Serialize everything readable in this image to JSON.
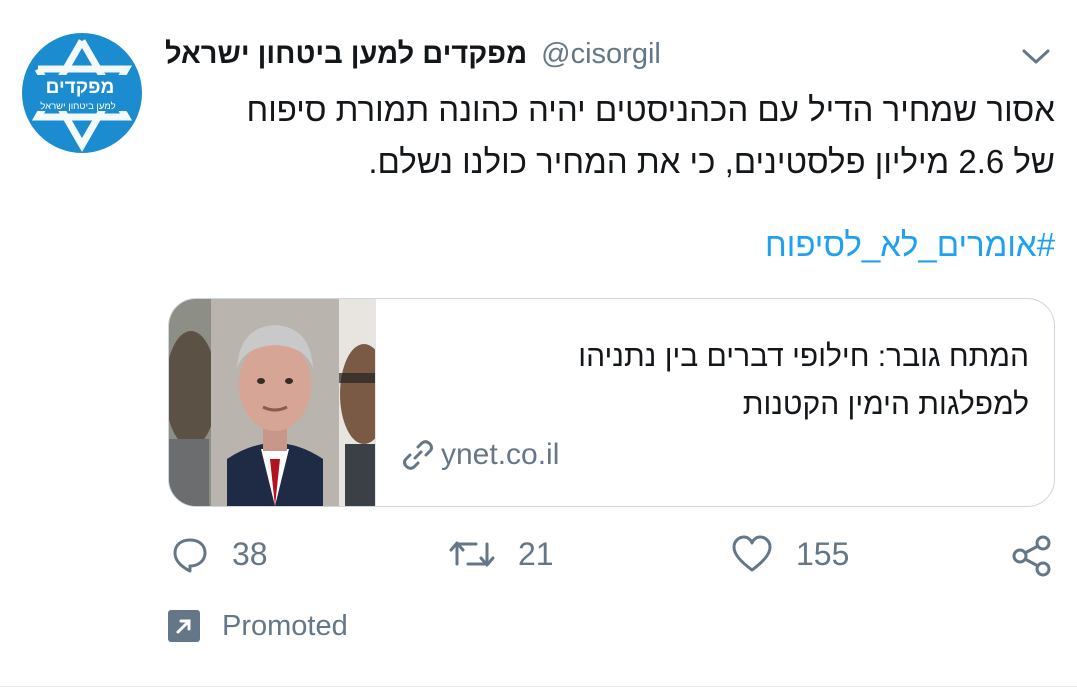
{
  "tweet": {
    "display_name": "מפקדים למען ביטחון ישראל",
    "handle": "@cisorgil",
    "avatar": {
      "logo_title": "מפקדים",
      "logo_subtitle": "למען ביטחון ישראל"
    },
    "text_line1": "אסור שמחיר הדיל עם הכהניסטים יהיה כהונה תמורת סיפוח",
    "text_line2": "של 2.6 מיליון פלסטינים, כי את המחיר כולנו נשלם.",
    "hashtag": "#אומרים_לא_לסיפוח",
    "card": {
      "title_line1": "המתח גובר: חילופי דברים בין נתניהו",
      "title_line2": "למפלגות הימין הקטנות",
      "domain": "ynet.co.il"
    },
    "actions": {
      "reply_count": "38",
      "retweet_count": "21",
      "like_count": "155"
    },
    "promoted_label": "Promoted"
  },
  "colors": {
    "brand_blue": "#1c8cd0",
    "link_blue": "#1da1f2",
    "secondary_text": "#657786"
  }
}
